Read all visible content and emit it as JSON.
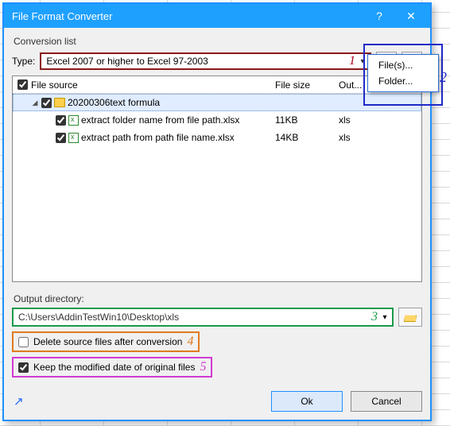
{
  "window": {
    "title": "File Format Converter",
    "help_label": "?",
    "close_label": "✕"
  },
  "section_conversion_list": "Conversion list",
  "type_row": {
    "label": "Type:",
    "combo_value": "Excel 2007 or higher to Excel 97-2003",
    "annot": "1"
  },
  "add_button": "＋",
  "del_button": "✖",
  "add_menu": {
    "files": "File(s)...",
    "folder": "Folder..."
  },
  "annot_menu": "2",
  "list": {
    "headers": {
      "source": "File source",
      "size": "File size",
      "out": "Out..."
    },
    "folder_row": {
      "name": "20200306text formula"
    },
    "rows": [
      {
        "name": "extract folder name from file path.xlsx",
        "size": "11KB",
        "out": "xls"
      },
      {
        "name": "extract path from path file name.xlsx",
        "size": "14KB",
        "out": "xls"
      }
    ]
  },
  "output": {
    "label": "Output directory:",
    "path": "C:\\Users\\AddinTestWin10\\Desktop\\xls",
    "annot": "3"
  },
  "opt_delete": {
    "label": "Delete source files after conversion",
    "annot": "4"
  },
  "opt_keepdate": {
    "label": "Keep the modified date of original files",
    "annot": "5"
  },
  "footer": {
    "ok": "Ok",
    "cancel": "Cancel"
  }
}
